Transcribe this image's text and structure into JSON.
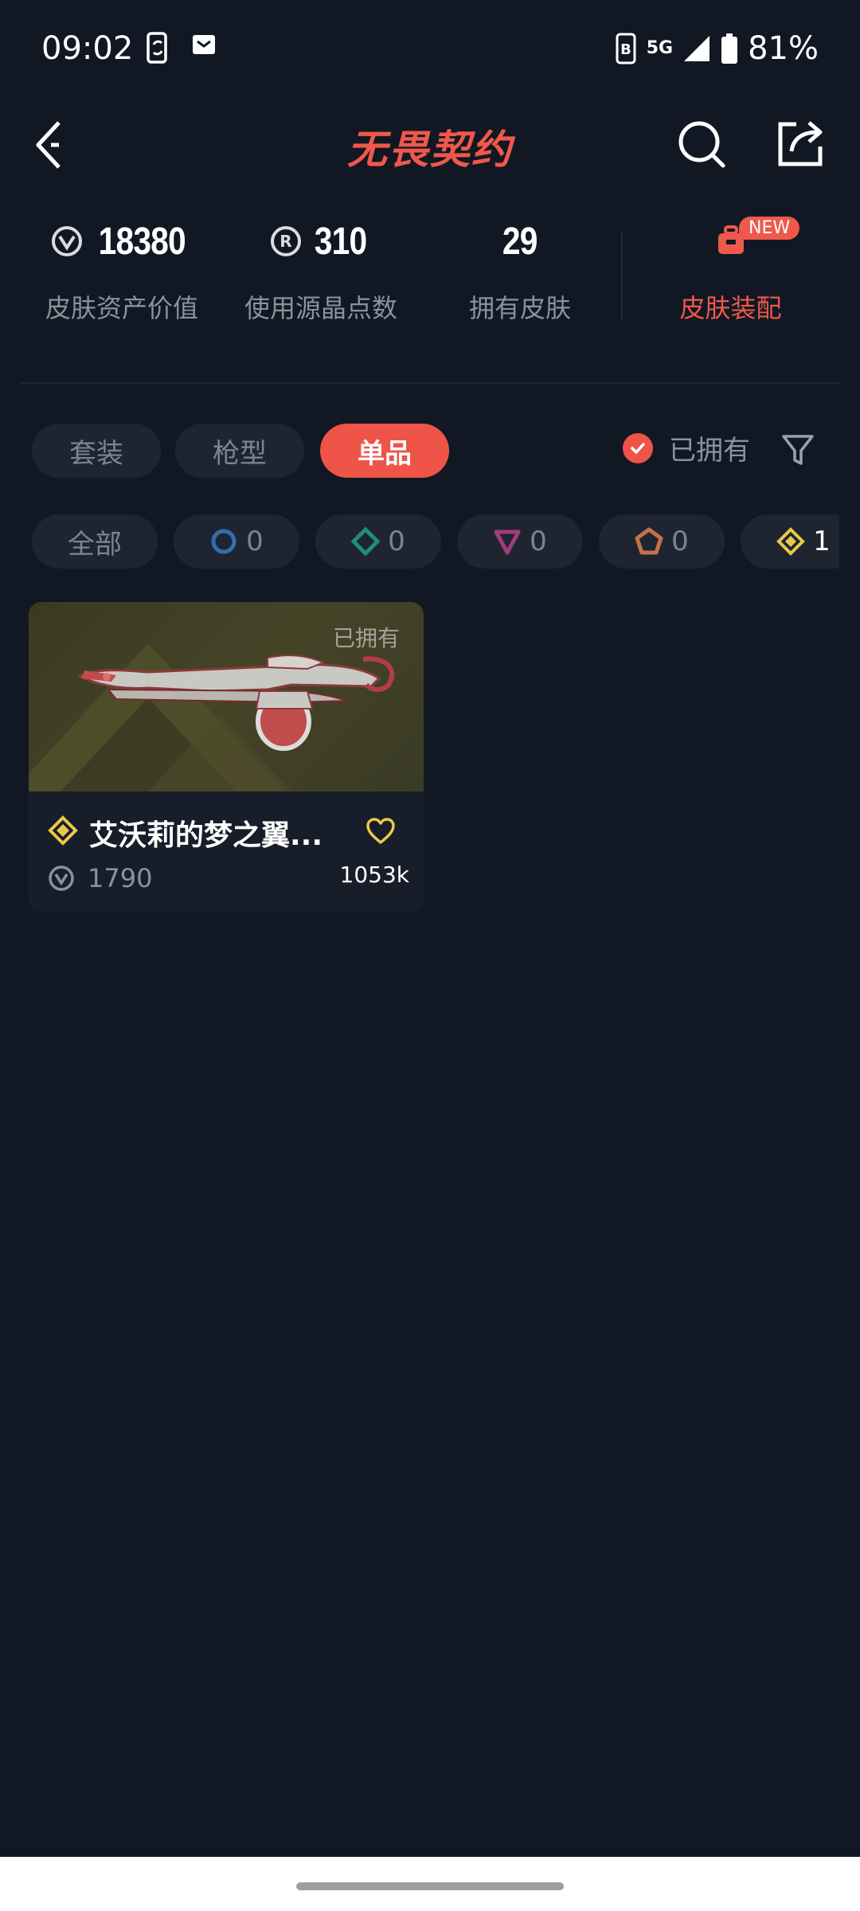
{
  "status_bar": {
    "time": "09:02",
    "network": "5G",
    "battery": "81%"
  },
  "header": {
    "title": "无畏契约"
  },
  "stats": {
    "asset_value": "18380",
    "asset_value_label": "皮肤资产价值",
    "radianite": "310",
    "radianite_label": "使用源晶点数",
    "owned_count": "29",
    "owned_count_label": "拥有皮肤",
    "equip_label": "皮肤装配",
    "equip_badge": "NEW"
  },
  "tabs": [
    {
      "label": "套装",
      "active": false
    },
    {
      "label": "枪型",
      "active": false
    },
    {
      "label": "单品",
      "active": true
    }
  ],
  "owned_filter": {
    "label": "已拥有",
    "checked": true
  },
  "rarity_chips": [
    {
      "label": "全部"
    },
    {
      "count": "0",
      "icon": "select-tier-icon",
      "color": "#2f6fae"
    },
    {
      "count": "0",
      "icon": "deluxe-tier-icon",
      "color": "#1f8d7b"
    },
    {
      "count": "0",
      "icon": "premium-tier-icon",
      "color": "#a33c7c"
    },
    {
      "count": "0",
      "icon": "exclusive-tier-icon",
      "color": "#c7704a"
    },
    {
      "count": "1",
      "icon": "ultra-tier-icon",
      "color": "#e9c94a"
    }
  ],
  "skins": [
    {
      "owned_tag": "已拥有",
      "name": "艾沃莉的梦之翼...",
      "price": "1790",
      "likes": "1053k",
      "tier_color": "#e9c94a"
    }
  ]
}
